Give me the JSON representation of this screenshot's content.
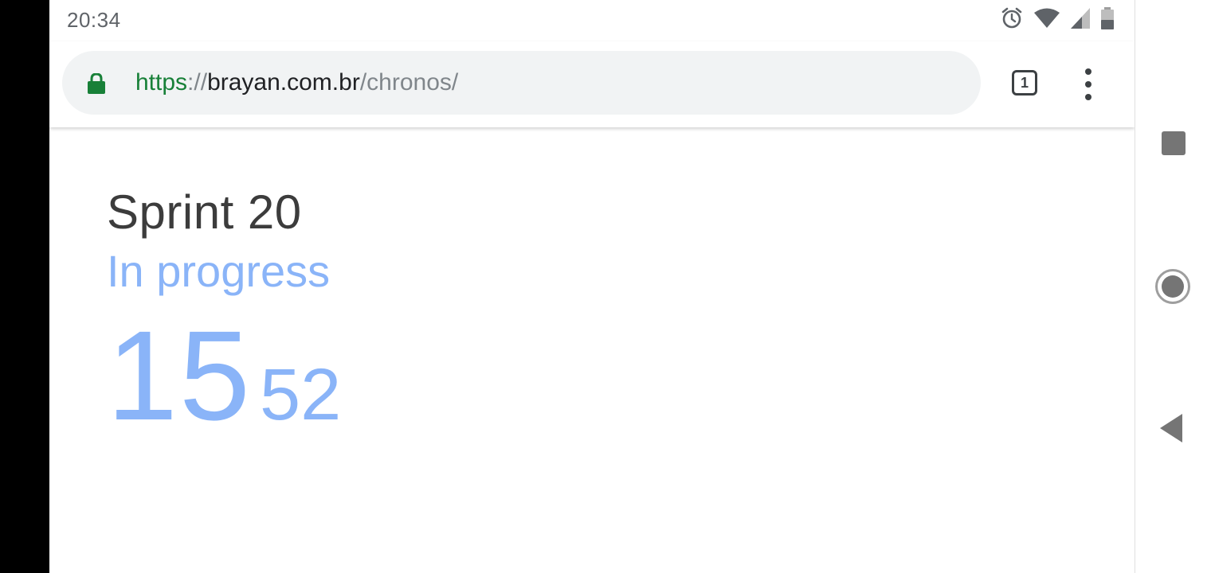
{
  "status_bar": {
    "time": "20:34",
    "icons": [
      "alarm-icon",
      "wifi-icon",
      "signal-icon",
      "battery-icon"
    ]
  },
  "browser": {
    "url": {
      "scheme": "https",
      "separator": "://",
      "host": "brayan.com.br",
      "path": "/chronos/"
    },
    "tab_count": "1"
  },
  "page": {
    "title": "Sprint 20",
    "status": "In progress",
    "timer": {
      "major": "15",
      "minor": "52"
    }
  },
  "nav_bar": {
    "buttons": [
      "recents",
      "home",
      "back"
    ]
  },
  "colors": {
    "accent": "#8ab4f8",
    "title": "#3c3c3c",
    "secure_green": "#188038",
    "omnibox_bg": "#f1f3f4"
  }
}
